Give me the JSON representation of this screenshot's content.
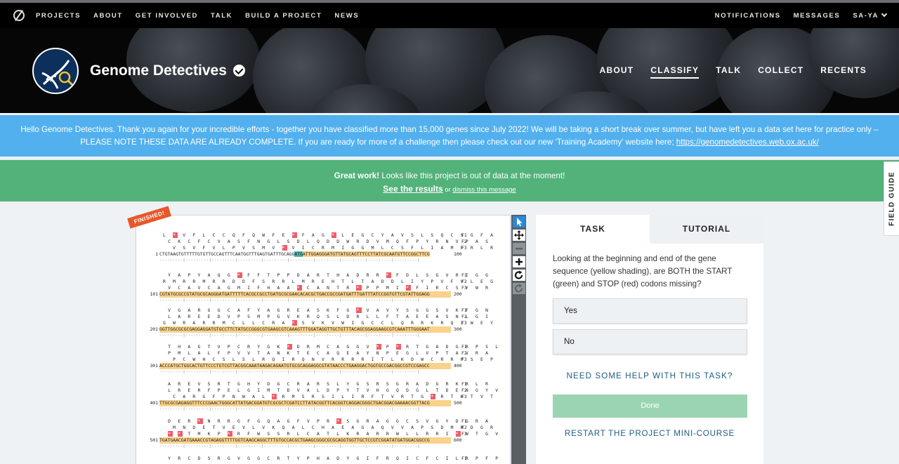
{
  "topnav": {
    "items": [
      "PROJECTS",
      "ABOUT",
      "GET INVOLVED",
      "TALK",
      "BUILD A PROJECT",
      "NEWS"
    ],
    "notifications": "NOTIFICATIONS",
    "messages": "MESSAGES",
    "user": "SA-YA"
  },
  "project": {
    "title": "Genome Detectives",
    "nav": [
      "ABOUT",
      "CLASSIFY",
      "TALK",
      "COLLECT",
      "RECENTS"
    ],
    "active_nav": "CLASSIFY"
  },
  "banner": {
    "text": "Hello Genome Detectives. Thank you again for your incredible efforts - together you have classified more than 15,000 genes since July 2022! We will be taking a short break over summer, but have left you a data set here for practice only – PLEASE NOTE THESE DATA ARE ALREADY COMPLETE. If you are ready for more of a challenge then please check out our new 'Training Academy' website here; ",
    "link": "https://genomedetectives.web.ox.ac.uk/"
  },
  "notice": {
    "strong": "Great work!",
    "text": " Looks like this project is out of data at the moment!",
    "see_results": "See the results",
    "or": " or ",
    "dismiss": "dismiss this message"
  },
  "field_guide": "FIELD GUIDE",
  "subject": {
    "badge": "FINISHED!",
    "frames": [
      "F1",
      "F2",
      "F3"
    ],
    "ruler": "----:----|----:----|----:----|----:----|----:----|----:----|----:----|----:----|----:----|----:----|",
    "blocks": [
      {
        "f1": "L * V F L C C Q F Q W F E * F A G * L E G C Y A V S L S Q C S G F A",
        "f2": " C K C F C V A S F N G L S D L Q D D W R D V M Q F P Y R N V P A S",
        "f3": "  V S V F V L P V S M V * V I C R M I G G M L C S F L I A M F R L R",
        "start": "1",
        "pre": "CTGTAAGTGTTTTTGTGTTGCCAGTTTCAATGGTTTGAGTGATTTGCAGG",
        "startcodon": "ATG",
        "post": "ATTGGAGGGATGTTATGCAGTTTCCTTATCGCAATGTTCCGGCTTCG",
        "end": "100"
      },
      {
        "f1": " Y A P Y A Q G * F F T P P D A R T H A D R R * F D L S G V R I G G",
        "f2": "R M R R M R R D D F S R R L M R E H T L T A D D L I Y P V F V L E G",
        "f3": " V C A V C A G M I F H A A * C A N T R * P P M I * F I R C S Y W R",
        "start": "101",
        "seq": "CGTATGCGCCGTATGCGCAGGGATGATTTTTCACGCCGCCTGATGCGCGAACACACGCTGACCGCCGATGATTTGATTTATCCGGTGTTCGTATTGGAGG",
        "end": "200"
      },
      {
        "f1": " V G A R G G C A F Y A G R E A S K F G * V A V Y S G G S V K F G N",
        "f2": " L A R E E D V P S M P G V K R Q S L D R L L F T A E E A S N L G I",
        "f3": "G W R A R R M C L L C R A * S V K V W I G C C L Q R R K R Q I W E Y",
        "start": "201",
        "seq": "GGTTGGCGCGCGAGGAGGATGTGCCTTCTATGCCGGGCGTGAAGCGTCAAAGTTTGGATAGGTTGCTGTTTACAGCGGAGGAAGCGTCAAATTTGGGAAT",
        "end": "300"
      },
      {
        "f1": " T H A G T V P C R Y G K * D R M C A G G V * P * R T G A D G R P S L",
        "f2": " P M L A L F P V V T A N K T E C A Q E A Y N P E G L V P T A V R A",
        "f3": "  P C W H C S L S L R Q I R Q N V R R R R I T L K D W C R R P S E P",
        "start": "301",
        "seq": "ACCCATGCTGGCACTGTTCCCTGTCGTTACGGCAAATAAGACAGAATGTGCGCAGGAGGCGTATAACCCTGAAGGACTGGTGCCGACGGCCGTCCGAGCC",
        "end": "400"
      },
      {
        "f1": " A R E V S R T G H Y D G C R A R S L Y G S R S G R A D G R K R L R",
        "f2": " L R E R F P E L G I M T D V A L D P Y T V H G Q D G L T D E N G Y V",
        "f3": "  C A R G F P N W A L * R M S R S I L I R F T V R T G * R T K T V T",
        "start": "401",
        "seq": "TTGCGCGAGAGGTTTCCCGAACTGGGCATTATGACGGATGTCGCGCTCGATCCTTATACGGTTCACGGTCAGGACGGGCTGACGGACGAAAACGGTTACG",
        "end": "500"
      },
      {
        "f1": " D E R * N R R G F G Q A G F V P R * S G R A G G C S V G Y D G R A",
        "f2": "  M N D E T V E V L V K Q A L C H A E A G A Q V V A P S D M M D G R",
        "f3": " * * T M K P * R F W S S R L C A T L K R A R R W L L R R I * W T G V",
        "start": "501",
        "seq": "TGATGAACGATGAAACCGTAGAGGTTTTGGTCAAGCAGGCTTTGTGCCACGCTGAAGCGGGCGCGCAGGTGGTTGCTCCGTCGGATATGATGGACGGCCG",
        "end": "600"
      },
      {
        "f1": " Y R C D S R G V G G C R T Y P H A D Y G I F R Q I C F C I L R P F P",
        "f2": "",
        "f3": "",
        "start": "",
        "seq": "",
        "end": ""
      }
    ]
  },
  "toolbar": [
    "pointer",
    "move",
    "zoom-out",
    "zoom-in",
    "rotate",
    "reset"
  ],
  "task": {
    "tabs": [
      "TASK",
      "TUTORIAL"
    ],
    "question": "Looking at the beginning and end of the gene sequence (yellow shading), are BOTH the START (green) and STOP (red) codons missing?",
    "answers": [
      "Yes",
      "No"
    ],
    "help": "NEED SOME HELP WITH THIS TASK?",
    "done": "Done",
    "restart": "RESTART THE PROJECT MINI-COURSE"
  },
  "colors": {
    "banner_blue": "#52b0ee",
    "banner_green": "#52b279",
    "gene_shading": "#f9d28b",
    "start_codon": "#4fb6b1",
    "stop_codon": "#f05c66",
    "done_button": "#9bd4b2",
    "link_blue": "#1e5d7f"
  }
}
